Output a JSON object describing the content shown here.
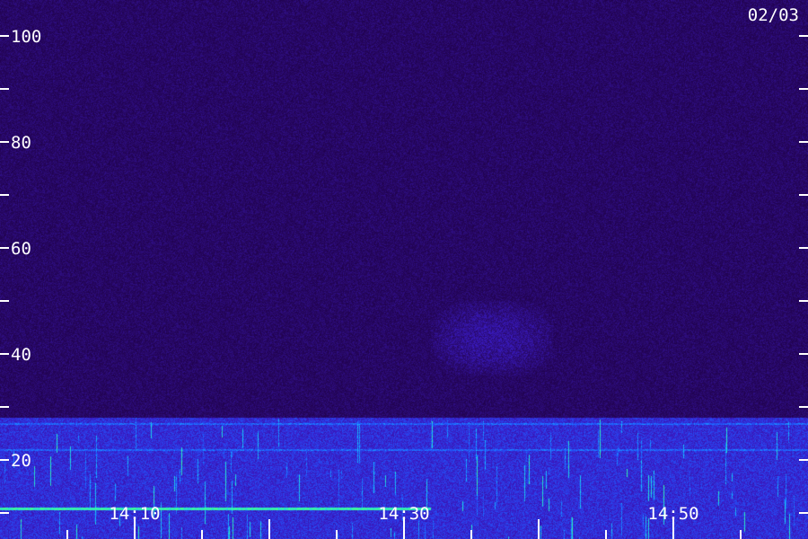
{
  "chart_data": {
    "type": "heatmap",
    "title": "",
    "date_label": "02/03",
    "xlabel": "",
    "ylabel": "",
    "x_ticks": [
      "14:10",
      "14:30",
      "14:50"
    ],
    "x_range_minutes": [
      "14:00",
      "15:00"
    ],
    "y_ticks": [
      20,
      40,
      60,
      80,
      100
    ],
    "ylim": [
      0,
      100
    ],
    "grid": false,
    "colormap": [
      "#1e0046",
      "#2a0a6e",
      "#3a1cc8",
      "#1f5bff",
      "#16c8ff",
      "#40ff90"
    ],
    "features": [
      {
        "kind": "noise-floor",
        "y_range": [
          28,
          100
        ],
        "level": 0.15
      },
      {
        "kind": "broadband-band",
        "y_range": [
          0,
          28
        ],
        "level": 0.45
      },
      {
        "kind": "diffuse-patch",
        "x_range": [
          "14:32",
          "14:41"
        ],
        "y_range": [
          36,
          50
        ],
        "level": 0.3
      },
      {
        "kind": "strong-line",
        "y": 11,
        "x_range": [
          "14:00",
          "14:32"
        ],
        "level": 0.95
      },
      {
        "kind": "strong-line",
        "y": 5,
        "x_range": [
          "14:00",
          "14:04"
        ],
        "level": 0.9
      },
      {
        "kind": "line",
        "y": 22,
        "x_range": [
          "14:00",
          "15:00"
        ],
        "level": 0.6
      },
      {
        "kind": "line",
        "y": 27,
        "x_range": [
          "14:00",
          "15:00"
        ],
        "level": 0.6
      }
    ]
  }
}
